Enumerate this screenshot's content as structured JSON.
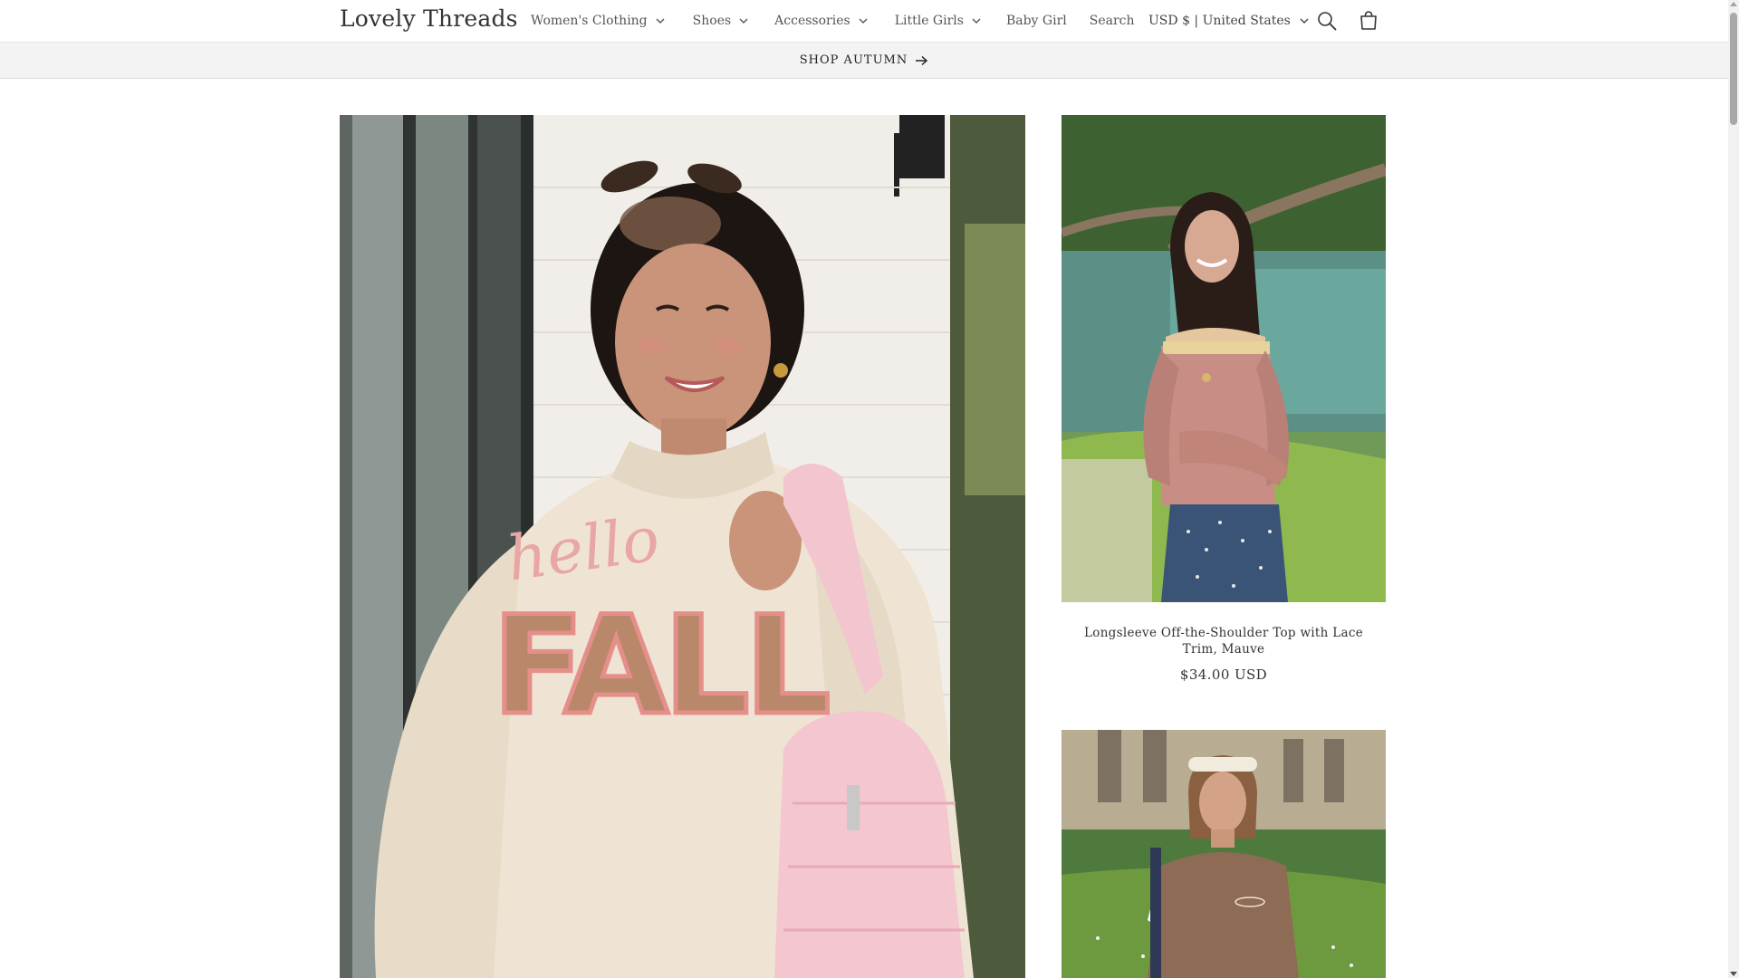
{
  "header": {
    "logo": "Lovely Threads",
    "nav": [
      {
        "label": "Women's Clothing",
        "has_dropdown": true
      },
      {
        "label": "Shoes",
        "has_dropdown": true
      },
      {
        "label": "Accessories",
        "has_dropdown": true
      },
      {
        "label": "Little Girls",
        "has_dropdown": true
      },
      {
        "label": "Baby Girl",
        "has_dropdown": false
      },
      {
        "label": "Search",
        "has_dropdown": false
      }
    ],
    "currency": "USD $ | United States",
    "icons": {
      "search": "search-icon",
      "cart": "cart-icon"
    }
  },
  "announcement": {
    "label": "SHOP AUTUMN",
    "icon": "arrow-right-icon"
  },
  "products": [
    {
      "title": "Longsleeve Off-the-Shoulder Top with Lace Trim, Mauve",
      "price": "$34.00 USD"
    }
  ],
  "hero": {
    "graphic_text_script": "hello",
    "graphic_text_block": "FALL"
  },
  "colors": {
    "announcement_bg": "#f3f3f3",
    "text": "#333333",
    "sweatshirt": "#efe4d4",
    "mauve_top": "#c88e85"
  }
}
